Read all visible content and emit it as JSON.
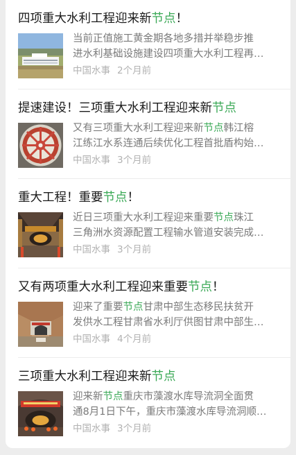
{
  "colors": {
    "highlight": "#3ba957",
    "title": "#1a1a1a",
    "snippet": "#7a7a7a",
    "meta": "#b2b2b2"
  },
  "articles": [
    {
      "title_before": "四项重大水利工程迎来新",
      "title_highlight": "节点",
      "title_after": "！",
      "thumb_icon": "white-building-landscape-photo",
      "snippet_line1_before": "当前正值施工黄金期各地多措并举稳步推",
      "snippet_line1_highlight": "",
      "snippet_line1_after": "",
      "snippet_line2": "进水利基础设施建设四项重大水利工程再…",
      "source": "中国水事",
      "time": "2个月前"
    },
    {
      "title_before": "提速建设！三项重大水利工程迎来新",
      "title_highlight": "节点",
      "title_after": "",
      "thumb_icon": "tunnel-boring-machine-photo",
      "snippet_line1_before": "又有三项重大水利工程迎来新",
      "snippet_line1_highlight": "节点",
      "snippet_line1_after": "韩江榕",
      "snippet_line2": "江练江水系连通后续优化工程首批盾构始…",
      "source": "中国水事",
      "time": "3个月前"
    },
    {
      "title_before": "重大工程！重要",
      "title_highlight": "节点",
      "title_after": "！",
      "thumb_icon": "pipeline-construction-photo",
      "snippet_line1_before": "近日三项重大水利工程迎来重要",
      "snippet_line1_highlight": "节点",
      "snippet_line1_after": "珠江",
      "snippet_line2": "三角洲水资源配置工程输水管道安装完成…",
      "source": "中国水事",
      "time": "3个月前"
    },
    {
      "title_before": "又有两项重大水利工程迎来重要",
      "title_highlight": "节点",
      "title_after": "！",
      "thumb_icon": "canyon-tunnel-portal-photo",
      "snippet_line1_before": "迎来了重要",
      "snippet_line1_highlight": "节点",
      "snippet_line1_after": "甘肃中部生态移民扶贫开",
      "snippet_line2": "发供水工程甘肃省水利厅供图甘肃中部生…",
      "source": "中国水事",
      "time": "4个月前"
    },
    {
      "title_before": "三项重大水利工程迎来新",
      "title_highlight": "节点",
      "title_after": "",
      "thumb_icon": "tunnel-breakthrough-celebration-photo",
      "snippet_line1_before": "迎来新",
      "snippet_line1_highlight": "节点",
      "snippet_line1_after": "重庆市藻渡水库导流洞全面贯",
      "snippet_line2": "通8月1日下午，重庆市藻渡水库导流洞顺…",
      "source": "中国水事",
      "time": "3个月前"
    }
  ]
}
